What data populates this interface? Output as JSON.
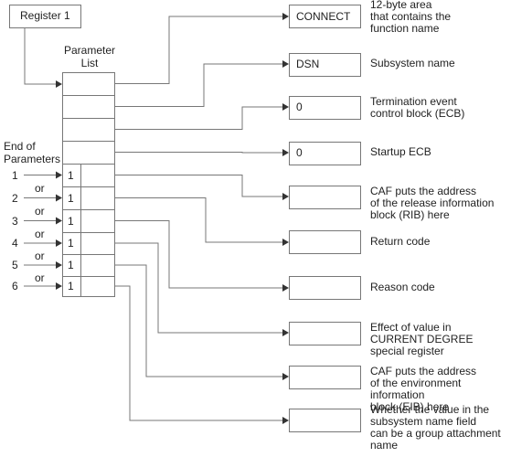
{
  "register_label": "Register 1",
  "param_list_label": [
    "Parameter",
    "List"
  ],
  "end_label": [
    "End of",
    "Parameters"
  ],
  "end_marker": "1",
  "numbers": [
    "1",
    "2",
    "3",
    "4",
    "5",
    "6"
  ],
  "or_label": "or",
  "targets": [
    {
      "value": "CONNECT",
      "desc": [
        "12-byte area",
        "that contains the",
        "function name"
      ]
    },
    {
      "value": "DSN",
      "desc": [
        "Subsystem name"
      ]
    },
    {
      "value": "0",
      "desc": [
        "Termination event",
        "control block (ECB)"
      ]
    },
    {
      "value": "0",
      "desc": [
        "Startup ECB"
      ]
    },
    {
      "value": "",
      "desc": [
        "CAF puts the address",
        "of the release information",
        "block (RIB) here"
      ]
    },
    {
      "value": "",
      "desc": [
        "Return code"
      ]
    },
    {
      "value": "",
      "desc": [
        "Reason code"
      ]
    },
    {
      "value": "",
      "desc": [
        "Effect of value in",
        "CURRENT DEGREE",
        "special register"
      ]
    },
    {
      "value": "",
      "desc": [
        "CAF puts the address",
        "of the environment information",
        "block (EIB) here"
      ]
    },
    {
      "value": "",
      "desc": [
        "Whether the value in the",
        "subsystem name field",
        "can be a group attachment",
        "name"
      ]
    }
  ]
}
